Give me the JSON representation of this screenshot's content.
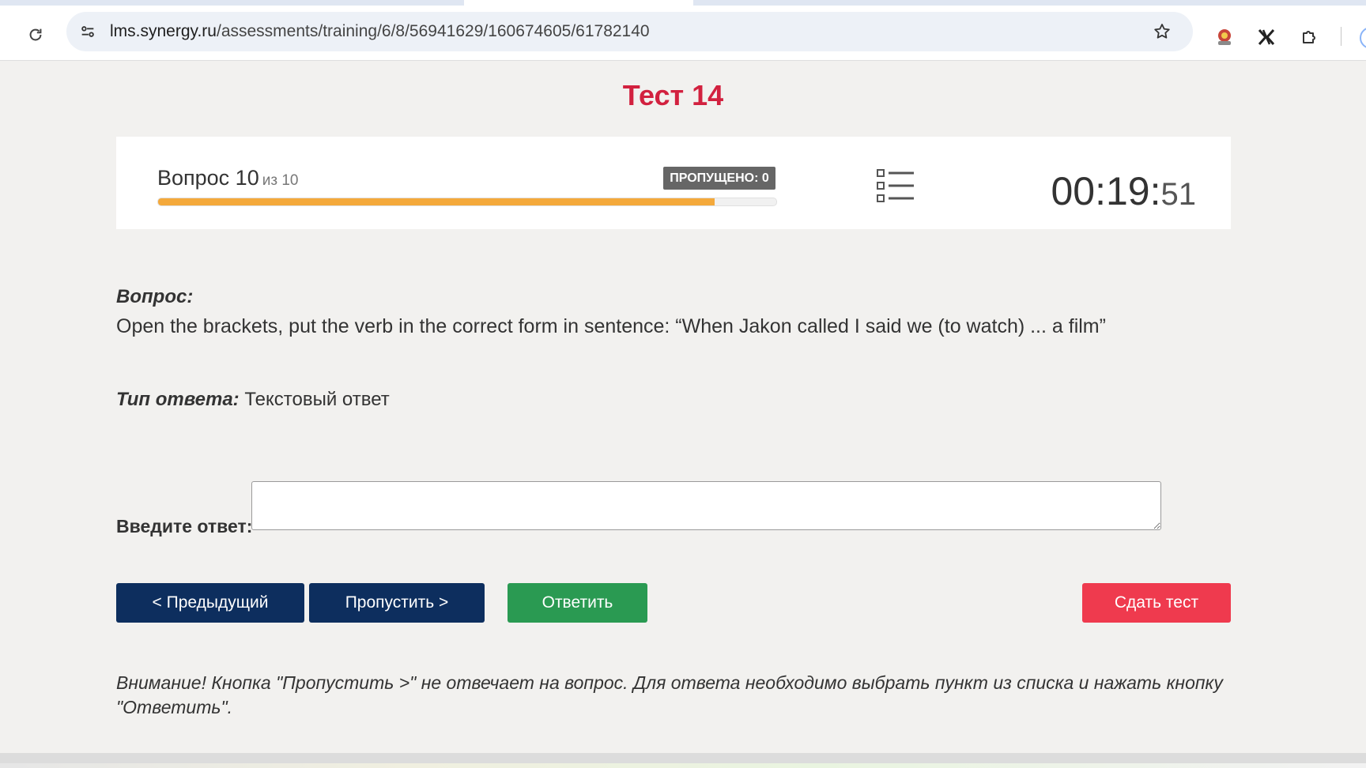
{
  "browser": {
    "url_host": "lms.synergy.ru",
    "url_path": "/assessments/training/6/8/56941629/160674605/61782140",
    "icons": [
      "reload-icon",
      "site-info-icon",
      "bookmark-star-icon",
      "extension-icon",
      "extension-icon",
      "puzzle-icon"
    ]
  },
  "page": {
    "title": "Тест 14",
    "title_color": "#d2213f"
  },
  "progress": {
    "question_label": "Вопрос 10",
    "question_of": "из 10",
    "skipped_label": "ПРОПУЩЕНО: 0",
    "progress_fraction": 0.9,
    "progress_color": "#f4a93b",
    "timer_main": "00:19:",
    "timer_seconds": "51"
  },
  "question": {
    "heading": "Вопрос:",
    "text": "Open the brackets, put the verb in the correct form in sentence: “When Jakon called I said we (to watch) ... a film”",
    "answer_type_label": "Тип ответа:",
    "answer_type_value": "Текстовый ответ"
  },
  "answer": {
    "label": "Введите ответ:",
    "value": ""
  },
  "buttons": {
    "prev": "< Предыдущий",
    "skip": "Пропустить >",
    "answer": "Ответить",
    "submit": "Сдать тест",
    "colors": {
      "nav": "#0d2e5e",
      "answer": "#2a9a52",
      "submit": "#ef3a4e"
    }
  },
  "warning": "Внимание! Кнопка \"Пропустить >\" не отвечает на вопрос. Для ответа необходимо выбрать пункт из списка и нажать кнопку \"Ответить\"."
}
